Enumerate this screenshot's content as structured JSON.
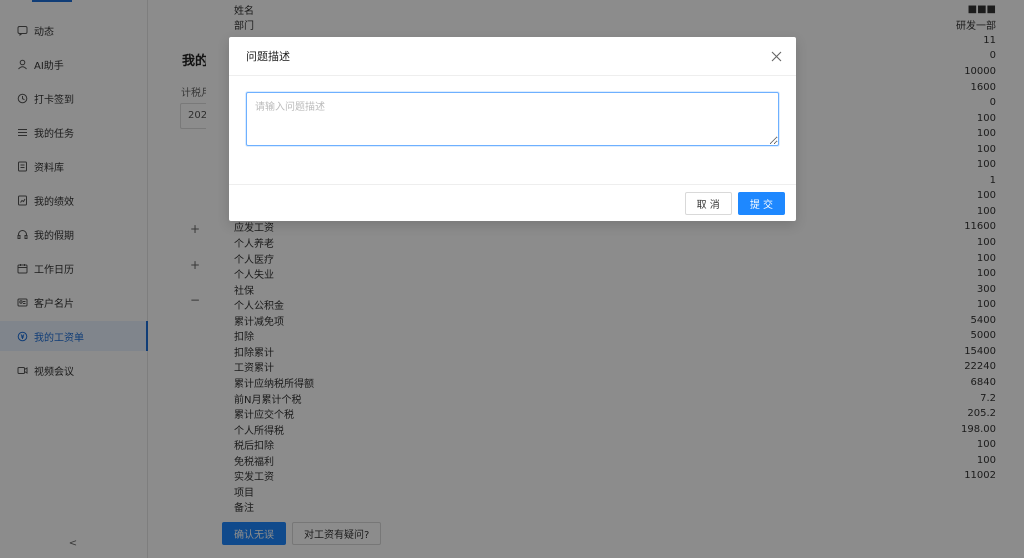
{
  "sidebar": {
    "items": [
      {
        "label": "动态",
        "icon": "chat-icon"
      },
      {
        "label": "AI助手",
        "icon": "user-icon"
      },
      {
        "label": "打卡签到",
        "icon": "clock-icon"
      },
      {
        "label": "我的任务",
        "icon": "list-icon"
      },
      {
        "label": "资料库",
        "icon": "folder-icon"
      },
      {
        "label": "我的绩效",
        "icon": "chart-icon"
      },
      {
        "label": "我的假期",
        "icon": "headphone-icon"
      },
      {
        "label": "工作日历",
        "icon": "calendar-icon"
      },
      {
        "label": "客户名片",
        "icon": "card-icon"
      },
      {
        "label": "我的工资单",
        "icon": "money-icon"
      },
      {
        "label": "视频会议",
        "icon": "video-icon"
      }
    ],
    "active_index": 9,
    "collapse_symbol": "<"
  },
  "middle": {
    "title": "我的",
    "label": "计税月",
    "select_value": "202",
    "symbols": [
      "+",
      "+",
      "−"
    ]
  },
  "payslip": {
    "rows": [
      {
        "label": "姓名",
        "value": "■■■"
      },
      {
        "label": "部门",
        "value": "研发一部"
      },
      {
        "label": "",
        "value": "11"
      },
      {
        "label": "",
        "value": "0"
      },
      {
        "label": "",
        "value": "10000"
      },
      {
        "label": "",
        "value": "1600"
      },
      {
        "label": "",
        "value": "0"
      },
      {
        "label": "",
        "value": "100"
      },
      {
        "label": "",
        "value": "100"
      },
      {
        "label": "",
        "value": "100"
      },
      {
        "label": "",
        "value": "100"
      },
      {
        "label": "",
        "value": "1"
      },
      {
        "label": "",
        "value": "100"
      },
      {
        "label": "",
        "value": "100"
      },
      {
        "label": "应发工资",
        "value": "11600"
      },
      {
        "label": "个人养老",
        "value": "100"
      },
      {
        "label": "个人医疗",
        "value": "100"
      },
      {
        "label": "个人失业",
        "value": "100"
      },
      {
        "label": "社保",
        "value": "300"
      },
      {
        "label": "个人公积金",
        "value": "100"
      },
      {
        "label": "累计减免项",
        "value": "5400"
      },
      {
        "label": "扣除",
        "value": "5000"
      },
      {
        "label": "扣除累计",
        "value": "15400"
      },
      {
        "label": "工资累计",
        "value": "22240"
      },
      {
        "label": "累计应纳税所得额",
        "value": "6840"
      },
      {
        "label": "前N月累计个税",
        "value": "7.2"
      },
      {
        "label": "累计应交个税",
        "value": "205.2"
      },
      {
        "label": "个人所得税",
        "value": "198.00"
      },
      {
        "label": "税后扣除",
        "value": "100"
      },
      {
        "label": "免税福利",
        "value": "100"
      },
      {
        "label": "实发工资",
        "value": "11002"
      },
      {
        "label": "项目",
        "value": ""
      },
      {
        "label": "备注",
        "value": ""
      }
    ],
    "confirm_label": "确认无误",
    "question_label": "对工资有疑问?"
  },
  "modal": {
    "title": "问题描述",
    "placeholder": "请输入问题描述",
    "value": "",
    "cancel_label": "取 消",
    "submit_label": "提 交"
  },
  "colors": {
    "primary": "#1e88ff",
    "mask": "rgba(0,0,0,0.45)"
  }
}
